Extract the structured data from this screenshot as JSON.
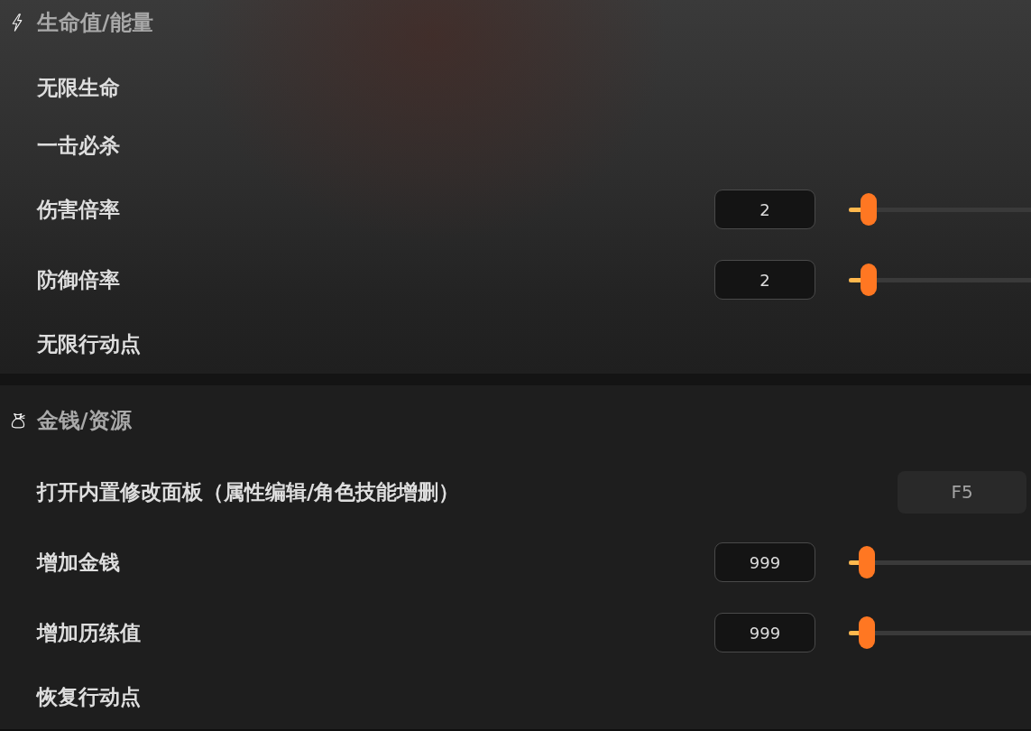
{
  "sections": [
    {
      "title": "生命值/能量",
      "items": [
        {
          "kind": "label",
          "label": "无限生命"
        },
        {
          "kind": "label",
          "label": "一击必杀"
        },
        {
          "kind": "slider",
          "label": "伤害倍率",
          "value": "2",
          "level": 0.11
        },
        {
          "kind": "slider",
          "label": "防御倍率",
          "value": "2",
          "level": 0.11
        },
        {
          "kind": "label",
          "label": "无限行动点"
        }
      ]
    },
    {
      "title": "金钱/资源",
      "items": [
        {
          "kind": "hotkey",
          "label": "打开内置修改面板（属性编辑/角色技能增删）",
          "key": "F5"
        },
        {
          "kind": "slider",
          "label": "增加金钱",
          "value": "999",
          "level": 0.1
        },
        {
          "kind": "slider",
          "label": "增加历练值",
          "value": "999",
          "level": 0.1
        },
        {
          "kind": "label",
          "label": "恢复行动点"
        }
      ]
    }
  ]
}
